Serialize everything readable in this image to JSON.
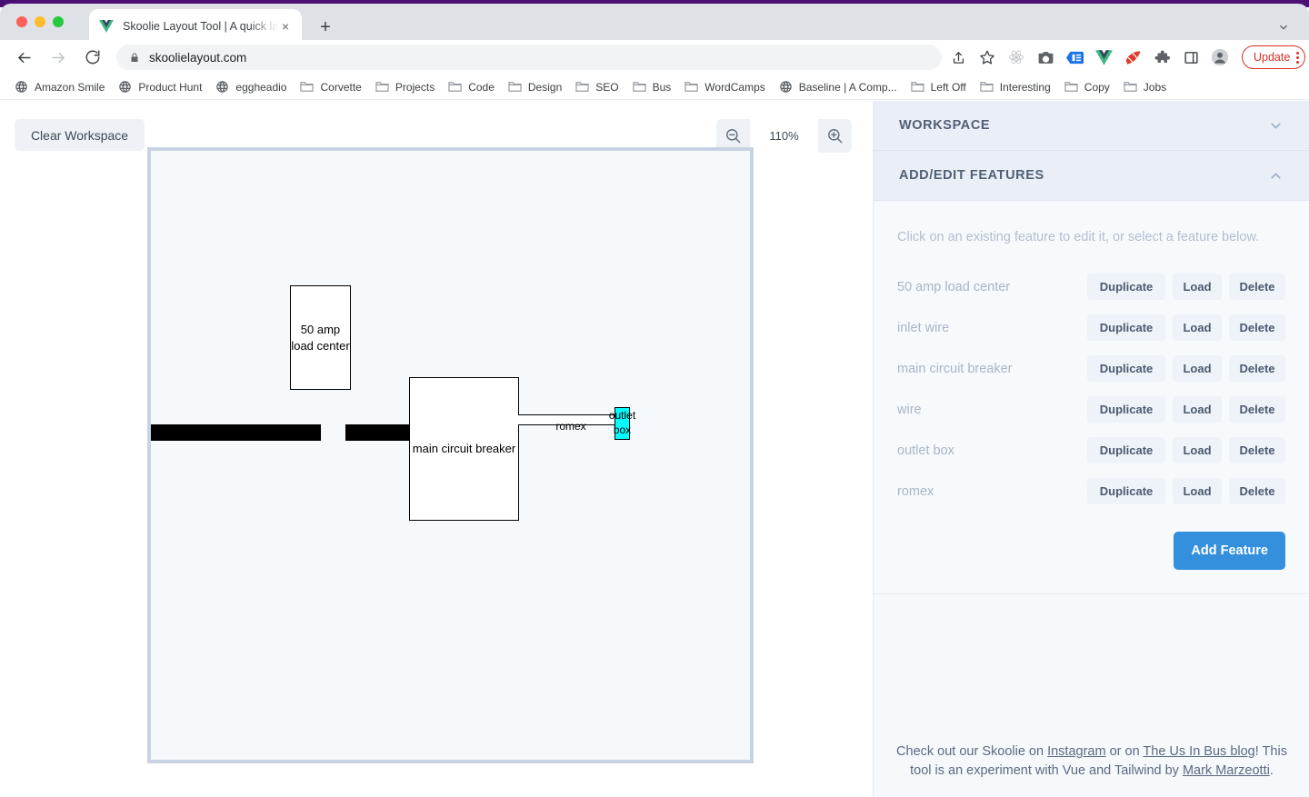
{
  "browser": {
    "tab": {
      "title": "Skoolie Layout Tool | A quick la",
      "favicon": "vue-logo-icon",
      "close": "×",
      "new_tab": "+"
    },
    "toolbar": {
      "back": "back-arrow-icon",
      "forward": "forward-arrow-icon",
      "reload": "reload-icon",
      "lock": "lock-icon",
      "url": "skoolielayout.com",
      "update_label": "Update",
      "icons": [
        "share-icon",
        "star-icon",
        "react-devtools-icon",
        "camera-icon",
        "id-card-icon",
        "vue-devtools-icon",
        "rails-icon",
        "puzzle-extensions-icon",
        "side-panel-icon",
        "profile-avatar-icon"
      ]
    },
    "bookmarks": [
      {
        "label": "Amazon Smile",
        "icon": "globe-icon"
      },
      {
        "label": "Product Hunt",
        "icon": "globe-icon"
      },
      {
        "label": "eggheadio",
        "icon": "globe-icon"
      },
      {
        "label": "Corvette",
        "icon": "folder-icon"
      },
      {
        "label": "Projects",
        "icon": "folder-icon"
      },
      {
        "label": "Code",
        "icon": "folder-icon"
      },
      {
        "label": "Design",
        "icon": "folder-icon"
      },
      {
        "label": "SEO",
        "icon": "folder-icon"
      },
      {
        "label": "Bus",
        "icon": "folder-icon"
      },
      {
        "label": "WordCamps",
        "icon": "folder-icon"
      },
      {
        "label": "Baseline | A Comp...",
        "icon": "globe-icon"
      },
      {
        "label": "Left Off",
        "icon": "folder-icon"
      },
      {
        "label": "Interesting",
        "icon": "folder-icon"
      },
      {
        "label": "Copy",
        "icon": "folder-icon"
      },
      {
        "label": "Jobs",
        "icon": "folder-icon"
      }
    ]
  },
  "workspace_toolbar": {
    "clear_label": "Clear Workspace",
    "zoom_out_icon": "zoom-out-icon",
    "zoom_in_icon": "zoom-in-icon",
    "zoom_level": "110%"
  },
  "canvas": {
    "features": [
      {
        "name": "inlet wire",
        "label": "",
        "type": "wire"
      },
      {
        "name": "50 amp load center",
        "label": "50 amp load center",
        "type": "box"
      },
      {
        "name": "wire",
        "label": "",
        "type": "wire"
      },
      {
        "name": "main circuit breaker",
        "label": "main circuit breaker",
        "type": "box"
      },
      {
        "name": "romex",
        "label": "romex",
        "type": "romex"
      },
      {
        "name": "outlet box",
        "label": "outlet box",
        "type": "box",
        "selected": true,
        "color": "#00ffff"
      }
    ],
    "load_center_label_line1": "50 amp",
    "load_center_label_line2": "load center",
    "breaker_label": "main circuit breaker",
    "romex_label": "romex",
    "outlet_label_line1": "outlet",
    "outlet_label_line2": "box"
  },
  "sidebar": {
    "panels": [
      {
        "title": "WORKSPACE",
        "chevron": "chevron-down-icon",
        "expanded": false
      },
      {
        "title": "ADD/EDIT FEATURES",
        "chevron": "chevron-up-icon",
        "expanded": true
      }
    ],
    "hint": "Click on an existing feature to edit it, or select a feature below.",
    "buttons": {
      "duplicate": "Duplicate",
      "load": "Load",
      "delete": "Delete"
    },
    "features": [
      {
        "name": "50 amp load center"
      },
      {
        "name": "inlet wire"
      },
      {
        "name": "main circuit breaker"
      },
      {
        "name": "wire"
      },
      {
        "name": "outlet box"
      },
      {
        "name": "romex"
      }
    ],
    "add_feature_label": "Add Feature",
    "accent_color": "#3490dc",
    "footer": {
      "part1": "Check out our Skoolie on ",
      "link1": "Instagram",
      "part2": " or on ",
      "link2": "The Us In Bus blog",
      "part3": "! This tool is an experiment with Vue and Tailwind by ",
      "link3": "Mark Marzeotti",
      "part4": "."
    }
  }
}
